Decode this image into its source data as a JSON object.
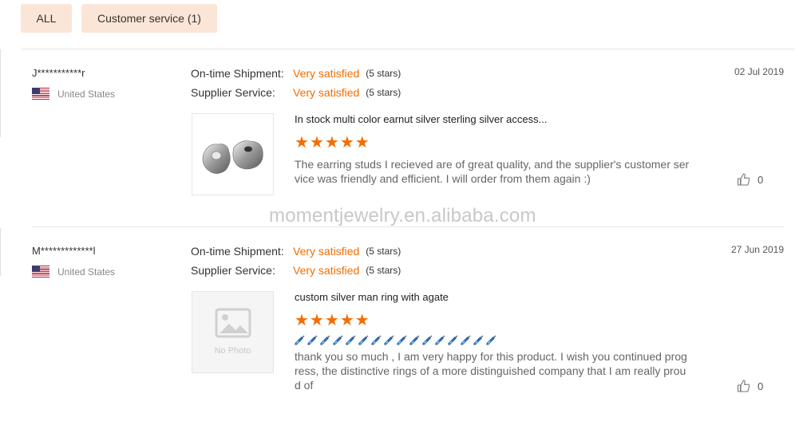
{
  "tabs": [
    {
      "label": "ALL"
    },
    {
      "label": "Customer service (1)"
    }
  ],
  "reviews": [
    {
      "user": "J***********r",
      "country": "United States",
      "date": "02 Jul 2019",
      "ratings": [
        {
          "label": "On-time Shipment:",
          "value": "Very satisfied",
          "stars": "(5 stars)"
        },
        {
          "label": "Supplier Service:",
          "value": "Very satisfied",
          "stars": "(5 stars)"
        }
      ],
      "product": "In stock multi color earnut silver sterling silver access...",
      "star_rating": 5,
      "comment": "The earring studs I recieved are of great quality, and the supplier's customer service was friendly and efficient. I will order from them again :)",
      "likes": "0"
    },
    {
      "user": "M*************l",
      "country": "United States",
      "date": "27 Jun 2019",
      "ratings": [
        {
          "label": "On-time Shipment:",
          "value": "Very satisfied",
          "stars": "(5 stars)"
        },
        {
          "label": "Supplier Service:",
          "value": "Very satisfied",
          "stars": "(5 stars)"
        }
      ],
      "product": "custom silver man ring with agate",
      "star_rating": 5,
      "no_photo": "No Photo",
      "emoji_count": 16,
      "comment": "thank you so much , I am very happy for this product. I wish you continued progress, the distinctive rings of a more distinguished company that I am really proud of",
      "likes": "0"
    }
  ],
  "watermark": "momentjewelry.en.alibaba.com",
  "colors": {
    "accent": "#f56c00",
    "tab_bg": "#fbe5d6"
  },
  "icons": {
    "like": "thumbs-up-icon",
    "flag": "us-flag-icon",
    "star": "star-icon"
  }
}
